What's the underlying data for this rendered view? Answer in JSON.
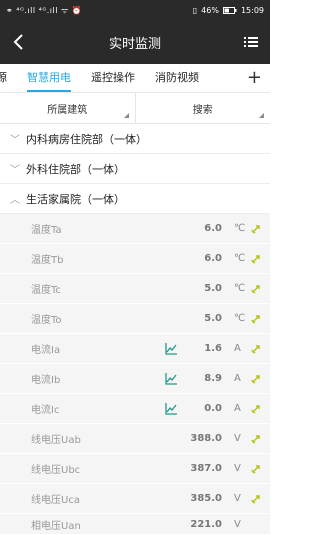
{
  "status": {
    "left": "⚭ ⁴ᴳ.ıll ⁴ᴳ.ıll ᯤ ⏰",
    "battery": "46%",
    "time": "15:09"
  },
  "header": {
    "title": "实时监测"
  },
  "tabs": [
    {
      "label": "源"
    },
    {
      "label": "智慧用电"
    },
    {
      "label": "遥控操作"
    },
    {
      "label": "消防视频"
    }
  ],
  "plus_label": "+",
  "filters": {
    "building": "所属建筑",
    "search": "搜索"
  },
  "groups": [
    {
      "label": "内科病房住院部（一体）"
    },
    {
      "label": "外科住院部（一体）"
    },
    {
      "label": "生活家属院（一体）"
    }
  ],
  "rows": [
    {
      "name": "温度Ta",
      "value": "6.0",
      "unit": "℃"
    },
    {
      "name": "温度Tb",
      "value": "6.0",
      "unit": "℃"
    },
    {
      "name": "温度Tc",
      "value": "5.0",
      "unit": "℃"
    },
    {
      "name": "温度To",
      "value": "5.0",
      "unit": "℃"
    },
    {
      "name": "电流Ia",
      "value": "1.6",
      "unit": "A"
    },
    {
      "name": "电流Ib",
      "value": "8.9",
      "unit": "A"
    },
    {
      "name": "电流Ic",
      "value": "0.0",
      "unit": "A"
    },
    {
      "name": "线电压Uab",
      "value": "388.0",
      "unit": "V"
    },
    {
      "name": "线电压Ubc",
      "value": "387.0",
      "unit": "V"
    },
    {
      "name": "线电压Uca",
      "value": "385.0",
      "unit": "V"
    },
    {
      "name": "相电压Uan",
      "value": "221.0",
      "unit": "V"
    }
  ],
  "colors": {
    "accent": "#2aa7e0",
    "chart_icon": "#1e9a8a",
    "link_icon": "#b8c41c"
  },
  "icons": {
    "back": "chevron-left-icon",
    "menu": "list-menu-icon",
    "chart": "line-chart-icon",
    "link": "link-icon"
  }
}
